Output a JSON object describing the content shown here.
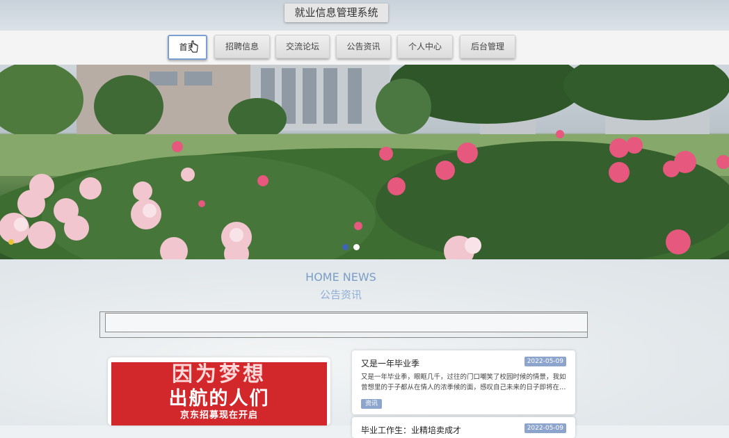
{
  "header": {
    "site_title": "就业信息管理系统"
  },
  "nav": {
    "items": [
      {
        "label": "首页",
        "active": true
      },
      {
        "label": "招聘信息",
        "active": false
      },
      {
        "label": "交流论坛",
        "active": false
      },
      {
        "label": "公告资讯",
        "active": false
      },
      {
        "label": "个人中心",
        "active": false
      },
      {
        "label": "后台管理",
        "active": false
      }
    ]
  },
  "hero": {
    "carousel_dots": 2,
    "active_dot": 1
  },
  "news_section": {
    "title_en": "HOME NEWS",
    "title_cn": "公告资讯",
    "promo": {
      "line1": "因为梦想",
      "line2": "出航的人们",
      "line3": "京东招募现在开启"
    },
    "cards": [
      {
        "title": "又是一年毕业季",
        "date": "2022-05-09",
        "summary_1": "又是一年毕业季，眼眶几千，过往的门口嘲笑了校园时候的情景，我如",
        "summary_2": "曾想里的于子都从在情人的浓季候的面，感叹自己未来的日子即将在…",
        "tag": "资讯"
      },
      {
        "title": "毕业工作生：业精培卖成才",
        "date": "2022-05-09"
      }
    ]
  },
  "colors": {
    "accent": "#7b9fd0",
    "tag_bg": "#8da5cc",
    "promo_red": "#d3282b"
  }
}
